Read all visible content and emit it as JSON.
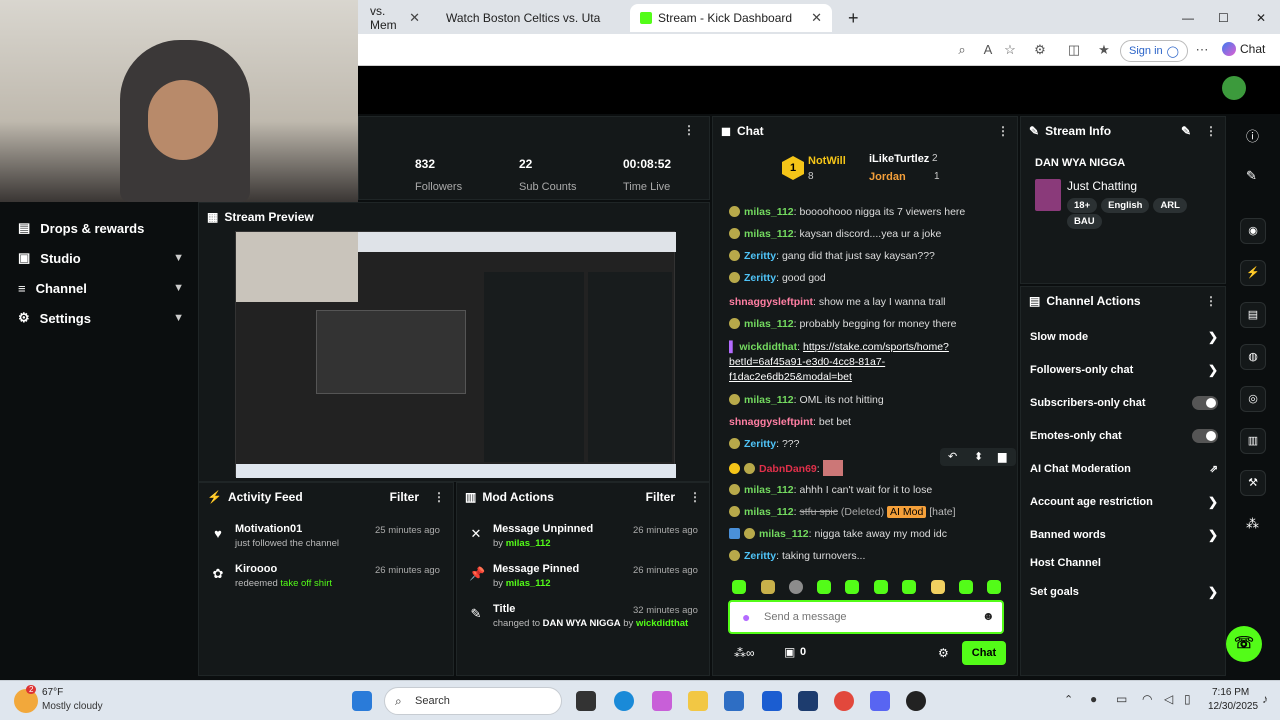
{
  "browser": {
    "tabs": [
      {
        "label": "vs. Mem",
        "active": false
      },
      {
        "label": "Watch Boston Celtics vs. Uta",
        "active": false
      },
      {
        "label": "Stream - Kick Dashboard",
        "active": true
      }
    ],
    "signin_label": "Sign in",
    "chat_label": "Chat"
  },
  "stats": [
    {
      "value": "832",
      "label": "Followers"
    },
    {
      "value": "22",
      "label": "Sub Counts"
    },
    {
      "value": "00:08:52",
      "label": "Time Live"
    }
  ],
  "sidebar": {
    "items": [
      {
        "label": "Drops & rewards"
      },
      {
        "label": "Studio"
      },
      {
        "label": "Channel"
      },
      {
        "label": "Settings"
      }
    ]
  },
  "stream_preview": {
    "title": "Stream Preview"
  },
  "activity_feed": {
    "title": "Activity Feed",
    "filter_label": "Filter",
    "items": [
      {
        "name": "Motivation01",
        "sub": "just followed the channel",
        "time": "25 minutes ago"
      },
      {
        "name": "Kiroooo",
        "sub_prefix": "redeemed",
        "sub_highlight": "take off shirt",
        "time": "26 minutes ago"
      }
    ]
  },
  "mod_actions": {
    "title": "Mod Actions",
    "filter_label": "Filter",
    "items": [
      {
        "title": "Message Unpinned",
        "by": "by",
        "user": "milas_112",
        "time": "26 minutes ago"
      },
      {
        "title": "Message Pinned",
        "by": "by",
        "user": "milas_112",
        "time": "26 minutes ago"
      },
      {
        "title": "Title",
        "by": "changed to",
        "value": "DAN WYA NIGGA",
        "by2": "by",
        "user": "wickdidthat",
        "time": "32 minutes ago"
      }
    ]
  },
  "chat": {
    "title": "Chat",
    "leaderboard": [
      {
        "rank": "1",
        "name": "NotWill",
        "count": "8"
      },
      {
        "name": "iLikeTurtlez",
        "count": "2"
      },
      {
        "name": "Jordan",
        "count": "1"
      }
    ],
    "messages": [
      {
        "user": "milas_112",
        "text": "boooohooo nigga its 7 viewers here"
      },
      {
        "user": "milas_112",
        "text": "kaysan discord....yea ur a joke"
      },
      {
        "user": "Zeritty",
        "text": "gang did that just say kaysan???"
      },
      {
        "user": "Zeritty",
        "text": "good god"
      },
      {
        "user": "shnaggysleftpint",
        "text": "show me a lay I wanna trall"
      },
      {
        "user": "milas_112",
        "text": "probably begging for money there"
      },
      {
        "user": "wickdidthat",
        "link_1": "https://stake.com/sports/home?",
        "link_2": "betId=6af45a91-e3d0-4cc8-81a7-",
        "link_3": "f1dac2e6db25&modal=bet"
      },
      {
        "user": "milas_112",
        "text": "OML its not hitting"
      },
      {
        "user": "shnaggysleftpint",
        "text": "bet bet"
      },
      {
        "user": "Zeritty",
        "text": "???"
      },
      {
        "user": "DabnDan69",
        "text": ""
      },
      {
        "user": "milas_112",
        "text": "ahhh I can't wait for it to lose"
      },
      {
        "user": "milas_112",
        "text": "stfu spic",
        "deleted": "(Deleted)",
        "ai_mod": "AI Mod",
        "reason": "[hate]"
      },
      {
        "user": "milas_112",
        "text": "nigga take away my mod idc"
      },
      {
        "user": "Zeritty",
        "text": "taking turnovers..."
      }
    ],
    "input_placeholder": "Send a message",
    "points": "0",
    "send_label": "Chat"
  },
  "stream_info": {
    "title": "Stream Info",
    "stream_title": "DAN WYA NIGGA",
    "category": "Just Chatting",
    "tags": [
      "18+",
      "English",
      "ARL",
      "BAU"
    ]
  },
  "channel_actions": {
    "title": "Channel Actions",
    "items": [
      {
        "label": "Slow mode",
        "control": "arrow"
      },
      {
        "label": "Followers-only chat",
        "control": "arrow"
      },
      {
        "label": "Subscribers-only chat",
        "control": "toggle"
      },
      {
        "label": "Emotes-only chat",
        "control": "toggle"
      },
      {
        "label": "AI Chat Moderation",
        "control": "external"
      },
      {
        "label": "Account age restriction",
        "control": "arrow"
      },
      {
        "label": "Banned words",
        "control": "arrow"
      },
      {
        "label": "Host Channel",
        "control": "none"
      },
      {
        "label": "Set goals",
        "control": "arrow"
      }
    ]
  },
  "taskbar": {
    "weather_temp": "67°F",
    "weather_desc": "Mostly cloudy",
    "weather_badge": "2",
    "search_label": "Search",
    "time": "7:16 PM",
    "date": "12/30/2025"
  },
  "colors": {
    "accent": "#53fc18",
    "panel": "#141819",
    "background": "#0b0e0f"
  }
}
